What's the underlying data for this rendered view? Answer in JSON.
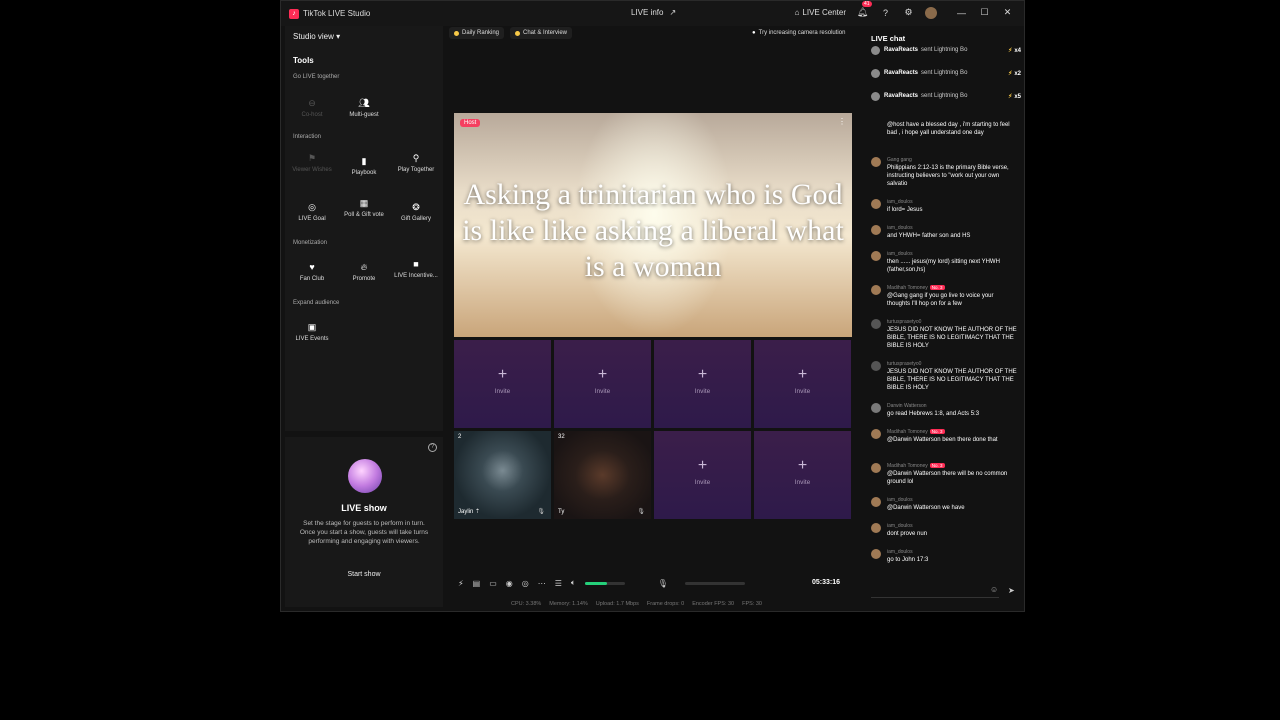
{
  "titlebar": {
    "app_title": "TikTok LIVE Studio",
    "center_title": "LIVE info",
    "live_center_label": "LIVE Center",
    "notif_count": "41"
  },
  "left": {
    "studio_view": "Studio view",
    "tools": "Tools",
    "sections": {
      "go_live_together": "Go LIVE together",
      "interaction": "Interaction",
      "monetization": "Monetization",
      "expand": "Expand audience"
    },
    "tools_list": {
      "cohost": "Co-host",
      "multiguest": "Multi-guest",
      "viewer_wishes": "Viewer Wishes",
      "playbook": "Playbook",
      "play_together": "Play Together",
      "live_goal": "LIVE Goal",
      "poll_gift_vote": "Poll & Gift vote",
      "gift_gallery": "Gift Gallery",
      "fan_club": "Fan Club",
      "promote": "Promote",
      "live_incentive": "LIVE Incentive...",
      "live_events": "LIVE Events"
    }
  },
  "live_show": {
    "title": "LIVE show",
    "desc": "Set the stage for guests to perform in turn. Once you start a show, guests will take turns performing and engaging with viewers.",
    "start_button": "Start show"
  },
  "topbar": {
    "daily_ranking": "Daily Ranking",
    "chat_interview": "Chat & Interview",
    "tip": "Try increasing camera resolution"
  },
  "stage": {
    "host_badge": "Host",
    "text": "Asking a trinitarian who is God is like like asking a liberal what is a woman"
  },
  "invite_label": "Invite",
  "guests": [
    {
      "count": "2",
      "name": "Jaylin ⇡"
    },
    {
      "count": "32",
      "name": "Ty"
    }
  ],
  "controls": {
    "timer": "05:33:16",
    "volume_fraction": 0.55
  },
  "stats": {
    "cpu": "CPU: 3.38%",
    "memory": "Memory: 1.14%",
    "upload": "Upload: 1.7 Mbps",
    "frame_drops": "Frame drops: 0",
    "encoder_fps": "Encoder FPS: 30",
    "fps": "FPS: 30"
  },
  "chat": {
    "title": "LIVE chat",
    "gifts": [
      {
        "user": "RavaReacts",
        "text": "sent Lightning Bo",
        "mult": "x4"
      },
      {
        "user": "RavaReacts",
        "text": "sent Lightning Bo",
        "mult": "x2"
      },
      {
        "user": "RavaReacts",
        "text": "sent Lightning Bo",
        "mult": "x5"
      }
    ],
    "messages": [
      {
        "user": "",
        "text": "@host have a blessed day , i'm starting to feel bad , i hope yall understand one day"
      },
      {
        "user": "Gang gang",
        "text": "Philippians 2:12-13 is the primary Bible verse, instructing believers to \"work out your own salvatio"
      },
      {
        "user": "iam_doulos",
        "text": "if lord= Jesus"
      },
      {
        "user": "iam_doulos",
        "text": "and YHWH= father son and HS"
      },
      {
        "user": "iam_doulos",
        "text": "then ...... jesus(my lord) sitting next YHWH (father,son,hs)"
      },
      {
        "user": "Madihah Tomoney",
        "tag": "No. 3",
        "text": "@Gang gang if you go live to voice your thoughts I'll hop on for a few"
      },
      {
        "user": "turtusprasetyo0",
        "text": "JESUS DID NOT KNOW THE AUTHOR OF THE BIBLE, THERE IS NO LEGITIMACY THAT THE BIBLE IS HOLY"
      },
      {
        "user": "turtusprasetyo0",
        "text": "JESUS DID NOT KNOW THE AUTHOR OF THE BIBLE, THERE IS NO LEGITIMACY THAT THE BIBLE IS HOLY"
      },
      {
        "user": "Darwin Watterson",
        "text": "go read Hebrews 1:8, and Acts 5:3"
      },
      {
        "user": "Madihah Tomoney",
        "tag": "No. 3",
        "text": "@Darwin Watterson been there done that"
      },
      {
        "user": "Madihah Tomoney",
        "tag": "No. 3",
        "text": "@Darwin Watterson there will be no common ground lol"
      },
      {
        "user": "iam_doulos",
        "text": "@Darwin Watterson we have"
      },
      {
        "user": "iam_doulos",
        "text": "dont prove nun"
      },
      {
        "user": "iam_doulos",
        "text": "go to John 17:3"
      }
    ]
  }
}
